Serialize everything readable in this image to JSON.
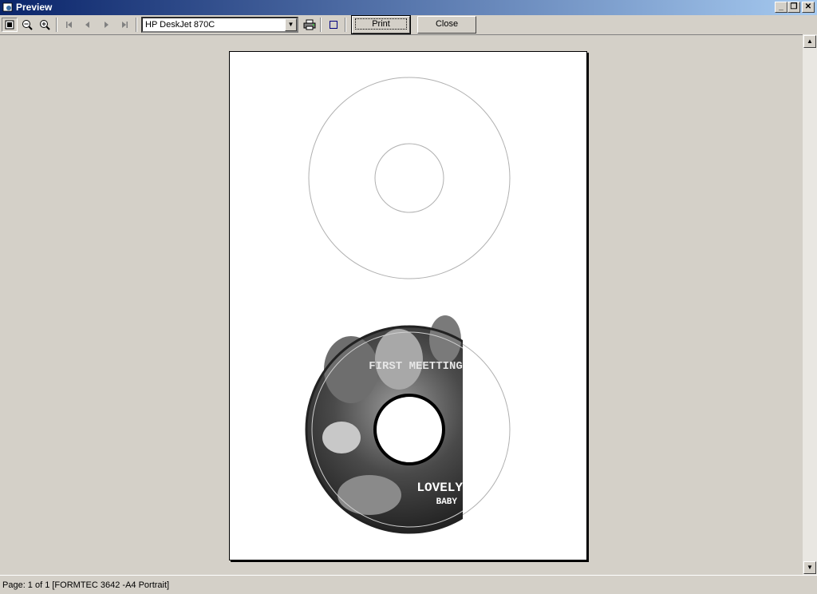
{
  "window": {
    "title": "Preview"
  },
  "toolbar": {
    "printer": "HP DeskJet 870C",
    "print_label": "Print",
    "close_label": "Close"
  },
  "label": {
    "top_text": "FIRST MEETTING",
    "bottom_text_1": "LOVELY",
    "bottom_text_2": "BABY"
  },
  "status": {
    "text": "Page: 1 of 1 [FORMTEC 3642 -A4 Portrait]"
  }
}
